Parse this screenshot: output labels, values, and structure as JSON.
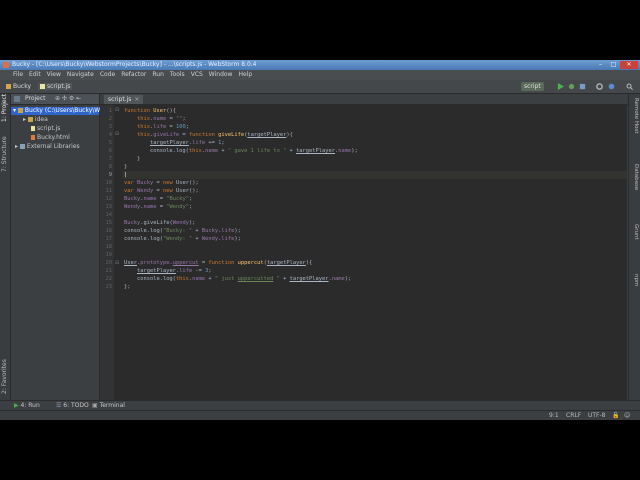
{
  "window": {
    "title": "Bucky - [C:\\Users\\Bucky\\WebstormProjects\\Bucky] - ...\\scripts.js - WebStorm 8.0.4",
    "btn_min": "–",
    "btn_max": "□",
    "btn_close": "✕"
  },
  "menu": [
    "File",
    "Edit",
    "View",
    "Navigate",
    "Code",
    "Refactor",
    "Run",
    "Tools",
    "VCS",
    "Window",
    "Help"
  ],
  "nav": {
    "crumb_project": "Bucky",
    "crumb_file": "script.js",
    "run_config": "script"
  },
  "left_strip": {
    "project": "1: Project",
    "structure": "7: Structure",
    "favorites": "2: Favorites"
  },
  "project_panel": {
    "header": "Project",
    "items": [
      {
        "label": "Bucky (C:\\Users\\Bucky\\W",
        "type": "folder",
        "selected": true,
        "indent": 0
      },
      {
        "label": "idea",
        "type": "folder",
        "selected": false,
        "indent": 1
      },
      {
        "label": "script.js",
        "type": "file",
        "selected": false,
        "indent": 1
      },
      {
        "label": "Bucky.html",
        "type": "file",
        "selected": false,
        "indent": 1
      },
      {
        "label": "External Libraries",
        "type": "folder",
        "selected": false,
        "indent": 0
      }
    ]
  },
  "editor": {
    "tab_label": "script.js",
    "tab_close": "×",
    "current_line": 9,
    "line_count": 23
  },
  "right_strip": {
    "remote_host": "Remote Host",
    "database": "Database",
    "grunt": "Grunt",
    "npm": "npm"
  },
  "bottom_tools": {
    "run": "4: Run",
    "todo": "6: TODO",
    "terminal": "Terminal"
  },
  "status": {
    "position": "9:1",
    "line_sep": "CRLF",
    "encoding": "UTF-8"
  },
  "colors": {
    "keyword": "#cc7832",
    "string": "#6a8759",
    "number": "#6897bb",
    "function": "#ffc66d",
    "property": "#9876aa",
    "identifier": "#a9b7c6"
  }
}
